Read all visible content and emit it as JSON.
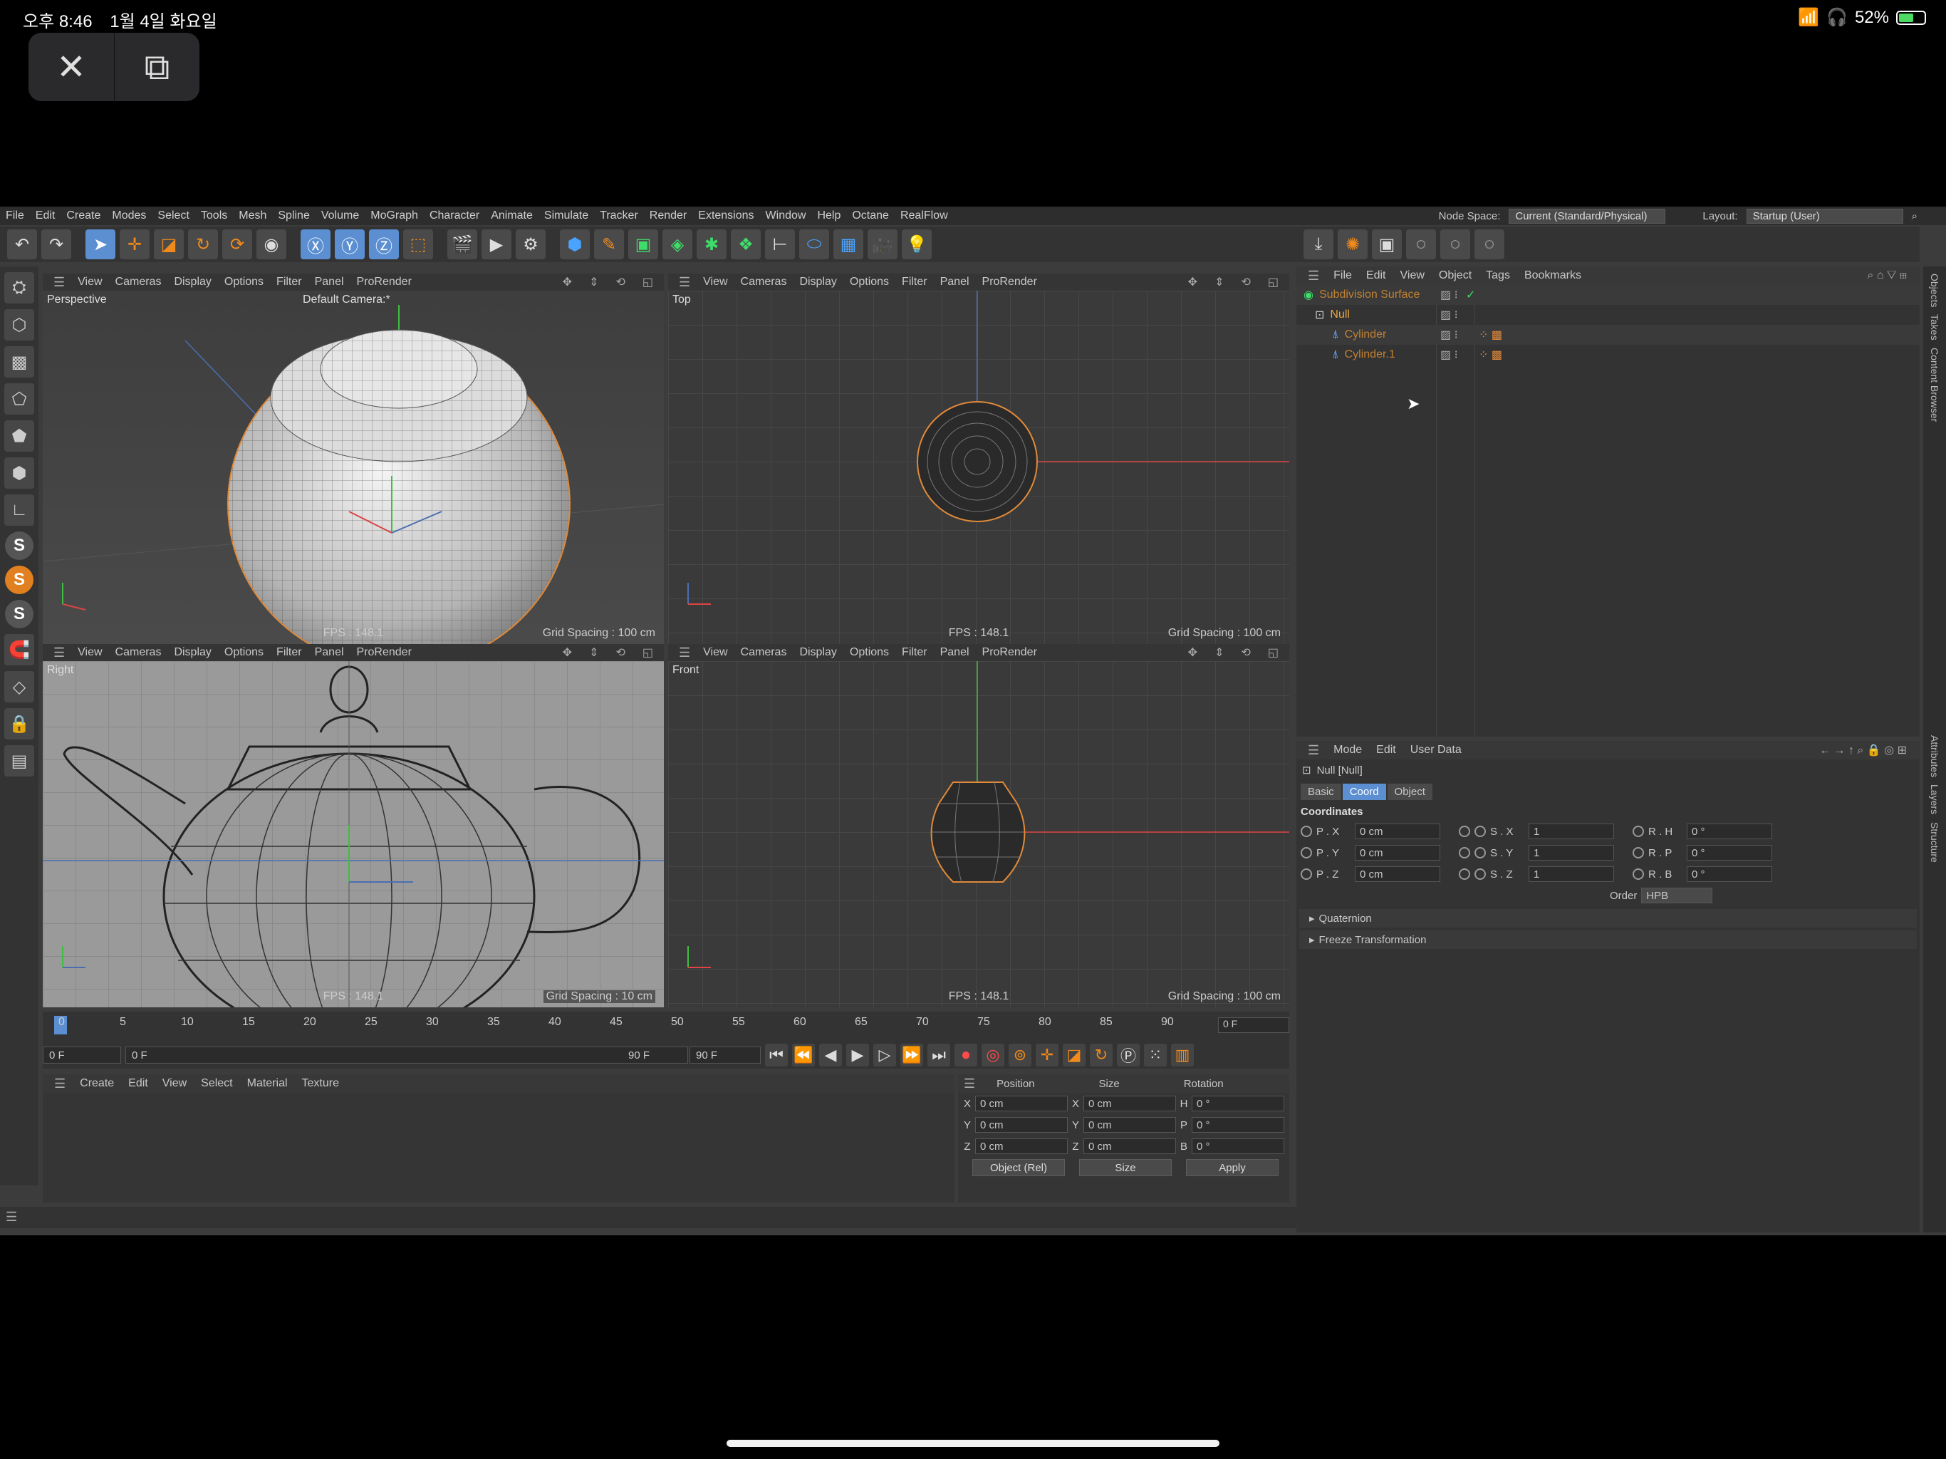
{
  "status": {
    "time": "오후 8:46",
    "date": "1월 4일 화요일",
    "battery": "52%",
    "battery_level": 0.52
  },
  "pip": {
    "close_icon": "x-icon",
    "restore_icon": "exit-pip-icon"
  },
  "menubar": {
    "items": [
      "File",
      "Edit",
      "Create",
      "Modes",
      "Select",
      "Tools",
      "Mesh",
      "Spline",
      "Volume",
      "MoGraph",
      "Character",
      "Animate",
      "Simulate",
      "Tracker",
      "Render",
      "Extensions",
      "Window",
      "Help",
      "Octane",
      "RealFlow"
    ],
    "node_space_label": "Node Space:",
    "node_space_value": "Current (Standard/Physical)",
    "layout_label": "Layout:",
    "layout_value": "Startup (User)"
  },
  "viewports": {
    "menu": [
      "View",
      "Cameras",
      "Display",
      "Options",
      "Filter",
      "Panel",
      "ProRender"
    ],
    "perspective": {
      "name": "Perspective",
      "camera": "Default Camera:*",
      "fps": "FPS : 148.1",
      "grid": "Grid Spacing : 100 cm"
    },
    "top": {
      "name": "Top",
      "fps": "FPS : 148.1",
      "grid": "Grid Spacing : 100 cm"
    },
    "right": {
      "name": "Right",
      "fps": "FPS : 148.1",
      "grid": "Grid Spacing : 10 cm"
    },
    "front": {
      "name": "Front",
      "fps": "FPS : 148.1",
      "grid": "Grid Spacing : 100 cm"
    }
  },
  "timeline": {
    "ticks": [
      "0",
      "5",
      "10",
      "15",
      "20",
      "25",
      "30",
      "35",
      "40",
      "45",
      "50",
      "55",
      "60",
      "65",
      "70",
      "75",
      "80",
      "85",
      "90"
    ],
    "current_frame": "0 F",
    "start": "0 F",
    "range_start": "0 F",
    "range_end": "90 F",
    "end": "90 F"
  },
  "material_manager": {
    "menu": [
      "Create",
      "Edit",
      "View",
      "Select",
      "Material",
      "Texture"
    ]
  },
  "coord_manager": {
    "headers": [
      "Position",
      "Size",
      "Rotation"
    ],
    "rows": [
      {
        "axis": "X",
        "pos": "0 cm",
        "size_axis": "X",
        "size": "0 cm",
        "rot_axis": "H",
        "rot": "0 °"
      },
      {
        "axis": "Y",
        "pos": "0 cm",
        "size_axis": "Y",
        "size": "0 cm",
        "rot_axis": "P",
        "rot": "0 °"
      },
      {
        "axis": "Z",
        "pos": "0 cm",
        "size_axis": "Z",
        "size": "0 cm",
        "rot_axis": "B",
        "rot": "0 °"
      }
    ],
    "mode": "Object (Rel)",
    "size_mode": "Size",
    "apply": "Apply"
  },
  "object_manager": {
    "menu": [
      "File",
      "Edit",
      "View",
      "Object",
      "Tags",
      "Bookmarks"
    ],
    "objects": [
      {
        "name": "Subdivision Surface",
        "indent": 0
      },
      {
        "name": "Null",
        "indent": 1
      },
      {
        "name": "Cylinder",
        "indent": 2
      },
      {
        "name": "Cylinder.1",
        "indent": 2
      }
    ]
  },
  "attributes": {
    "menu": [
      "Mode",
      "Edit",
      "User Data"
    ],
    "title": "Null [Null]",
    "tabs": [
      "Basic",
      "Coord",
      "Object"
    ],
    "section": "Coordinates",
    "rows": [
      {
        "p": "P . X",
        "pv": "0 cm",
        "s": "S . X",
        "sv": "1",
        "r": "R . H",
        "rv": "0 °"
      },
      {
        "p": "P . Y",
        "pv": "0 cm",
        "s": "S . Y",
        "sv": "1",
        "r": "R . P",
        "rv": "0 °"
      },
      {
        "p": "P . Z",
        "pv": "0 cm",
        "s": "S . Z",
        "sv": "1",
        "r": "R . B",
        "rv": "0 °"
      }
    ],
    "order_label": "Order",
    "order_value": "HPB",
    "quaternion": "Quaternion",
    "freeze": "Freeze Transformation"
  },
  "side_tabs": [
    "Objects",
    "Takes",
    "Content Browser",
    "Attributes",
    "Layers",
    "Structure"
  ]
}
